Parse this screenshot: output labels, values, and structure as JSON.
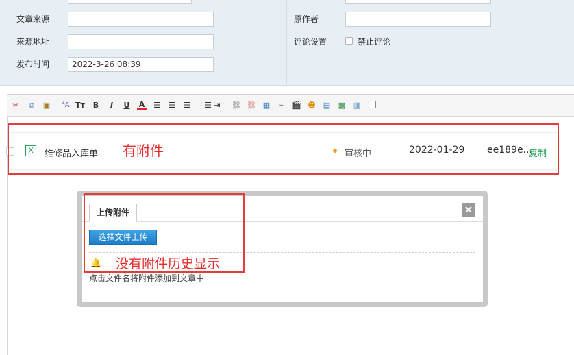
{
  "form": {
    "source_label": "文章来源",
    "source_url_label": "来源地址",
    "publish_time_label": "发布时间",
    "publish_time_value": "2022-3-26 08:39",
    "original_author_label": "原作者",
    "comment_settings_label": "评论设置",
    "disable_comments_label": "禁止评论"
  },
  "toolbar": {
    "icons": [
      "cut-icon",
      "copy-icon",
      "paste-icon",
      "format-painter-icon",
      "font-size-icon",
      "bold-icon",
      "italic-icon",
      "underline-icon",
      "font-color-icon",
      "align-left-icon",
      "align-center-icon",
      "align-right-icon",
      "ordered-list-icon",
      "indent-icon",
      "link-icon",
      "unlink-icon",
      "image-icon",
      "attachment-icon",
      "video-icon",
      "emoji-icon",
      "table-icon",
      "insert-image-icon",
      "page-break-icon",
      "checkbox-icon"
    ]
  },
  "attachment_row": {
    "file_icon_text": "X",
    "name": "维修品入库单",
    "status": "审核中",
    "date": "2022-01-29",
    "hash": "ee189e...",
    "copy_label": "复制",
    "status_dot_color": "#f0a030"
  },
  "annotations": {
    "has_attachment": "有附件",
    "no_history": "没有附件历史显示"
  },
  "dialog": {
    "tab_label": "上传附件",
    "upload_button": "选择文件上传",
    "hint": "点击文件名将附件添加到文章中",
    "close_label": "×"
  },
  "colors": {
    "annotation_red": "#e52d2d",
    "button_blue": "#1e8ad6",
    "copy_green": "#2aa35a"
  }
}
